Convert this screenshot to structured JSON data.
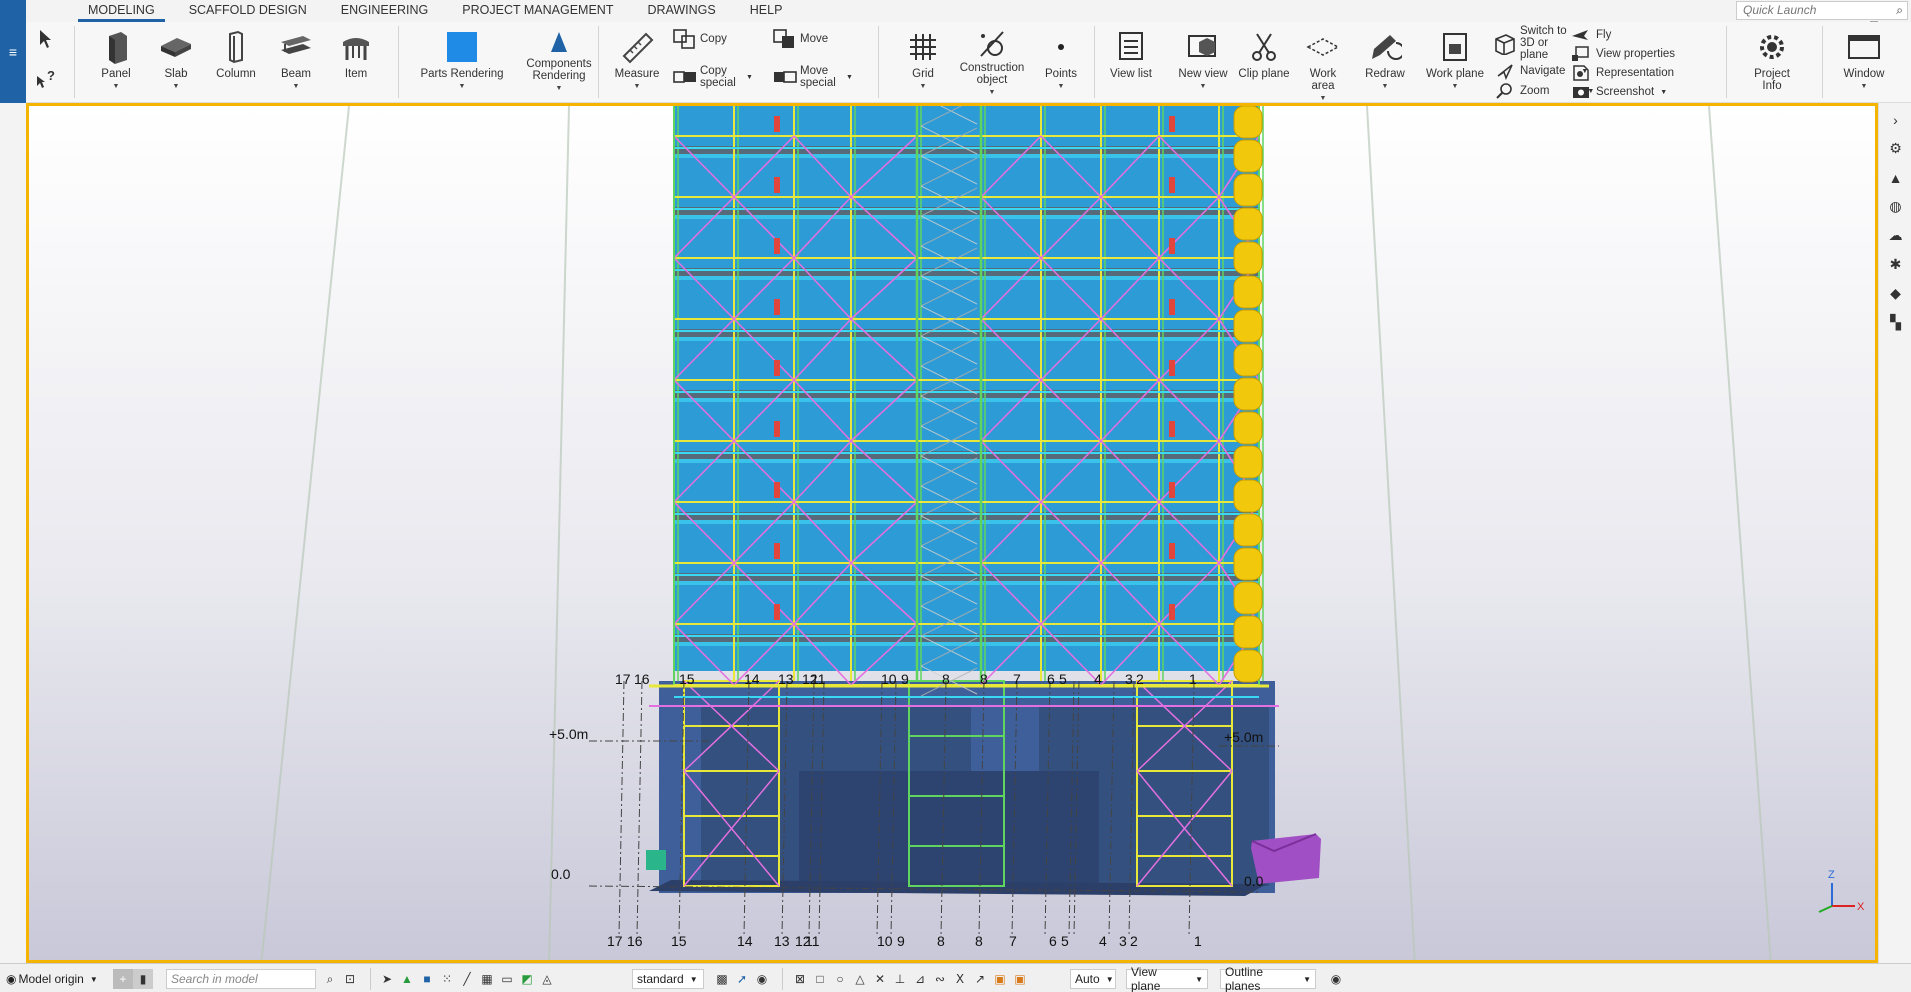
{
  "menu": {
    "app_icon": "hamburger-icon",
    "tabs": [
      "MODELING",
      "SCAFFOLD DESIGN",
      "ENGINEERING",
      "PROJECT MANAGEMENT",
      "DRAWINGS",
      "HELP"
    ],
    "active_tab": "MODELING",
    "quick_launch_placeholder": "Quick Launch"
  },
  "ribbon": {
    "modeling": {
      "panel": "Panel",
      "slab": "Slab",
      "column": "Column",
      "beam": "Beam",
      "item": "Item"
    },
    "rendering": {
      "parts_rendering": "Parts Rendering",
      "components_rendering": "Components Rendering"
    },
    "edit": {
      "measure": "Measure",
      "copy": "Copy",
      "copy_special": "Copy special",
      "move": "Move",
      "move_special": "Move special"
    },
    "geometry": {
      "grid": "Grid",
      "construction_object": "Construction object",
      "points": "Points"
    },
    "view": {
      "view_list": "View list",
      "new_view": "New view",
      "clip_plane": "Clip plane",
      "work_area": "Work area",
      "redraw": "Redraw",
      "work_plane": "Work plane",
      "switch_to_3d": "Switch to 3D or plane",
      "navigate": "Navigate",
      "zoom": "Zoom",
      "fly": "Fly",
      "view_properties": "View properties",
      "representation": "Representation",
      "screenshot": "Screenshot"
    },
    "project_info": "Project Info",
    "window": "Window"
  },
  "viewport": {
    "grid_labels_top": [
      "17",
      "16",
      "15",
      "14",
      "13",
      "12",
      "11",
      "10",
      "9",
      "8",
      "8",
      "7",
      "6",
      "5",
      "4",
      "3",
      "2",
      "1"
    ],
    "grid_labels_bottom": [
      "17",
      "16",
      "15",
      "14",
      "13",
      "12",
      "11",
      "10",
      "9",
      "8",
      "8",
      "7",
      "6",
      "5",
      "4",
      "3",
      "2",
      "1"
    ],
    "elevation_left_upper": "+5.0m",
    "elevation_right_upper": "+5.0m",
    "elevation_left_lower": "0.0",
    "elevation_right_lower": "0.0",
    "axis_z": "Z",
    "axis_x": "X",
    "colors": {
      "border": "#f5b400",
      "facade": "#2d9bd6",
      "base": "#3f5f9a",
      "bracing_magenta": "#e36fe0",
      "frame_yellow": "#e8e83a",
      "frame_green": "#5fd45f",
      "chute": "#f2c80d"
    }
  },
  "side_panel": {
    "icons": [
      "chevron-right-icon",
      "property-pane-icon",
      "learning-icon",
      "globe-icon",
      "cloud-icon",
      "settings-icon",
      "cube-icon",
      "apps-icon"
    ]
  },
  "statusbar": {
    "model_origin": "Model origin",
    "search_placeholder": "Search in model",
    "snap_mode": "standard",
    "auto_label": "Auto",
    "view_plane": "View plane",
    "outline_planes": "Outline planes"
  }
}
